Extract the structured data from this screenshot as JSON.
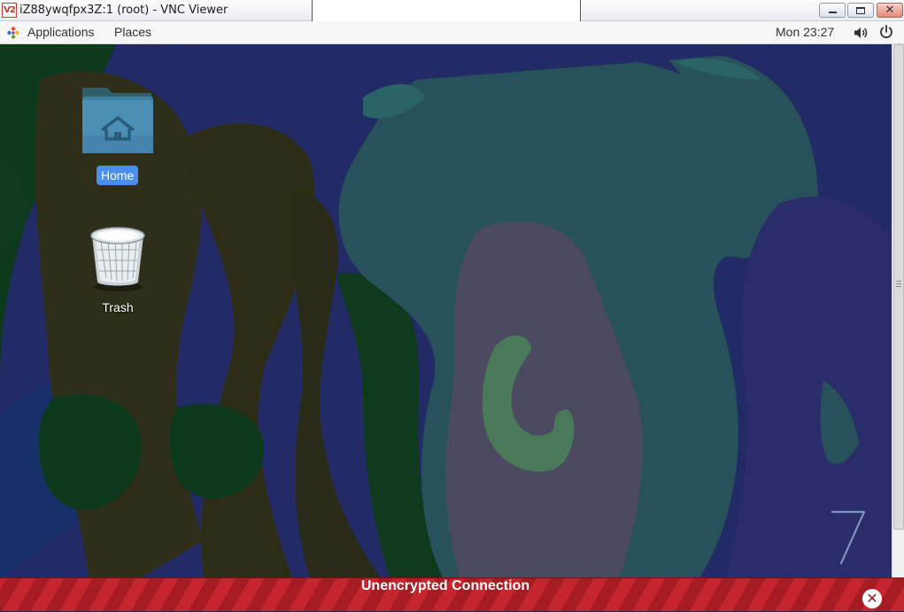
{
  "window": {
    "logo_text": "V2",
    "title": "iZ88ywqfpx3Z:1 (root) - VNC Viewer",
    "controls": {
      "minimize": "minimize",
      "maximize": "maximize",
      "close": "✕"
    }
  },
  "panel": {
    "applications_label": "Applications",
    "places_label": "Places",
    "clock": "Mon 23:27",
    "icons": [
      "applications-icon",
      "volume-icon",
      "power-icon"
    ]
  },
  "desktop": {
    "icons": [
      {
        "label": "Home",
        "icon": "home-folder-icon",
        "selected": true
      },
      {
        "label": "Trash",
        "icon": "trash-icon",
        "selected": false
      }
    ],
    "version_mark": "7"
  },
  "banner": {
    "text": "Unencrypted Connection",
    "close_symbol": "✕"
  },
  "colors": {
    "banner_red": "#c5252c",
    "selection_blue": "#4a8ef0",
    "wallpaper_navy": "#232b66"
  }
}
